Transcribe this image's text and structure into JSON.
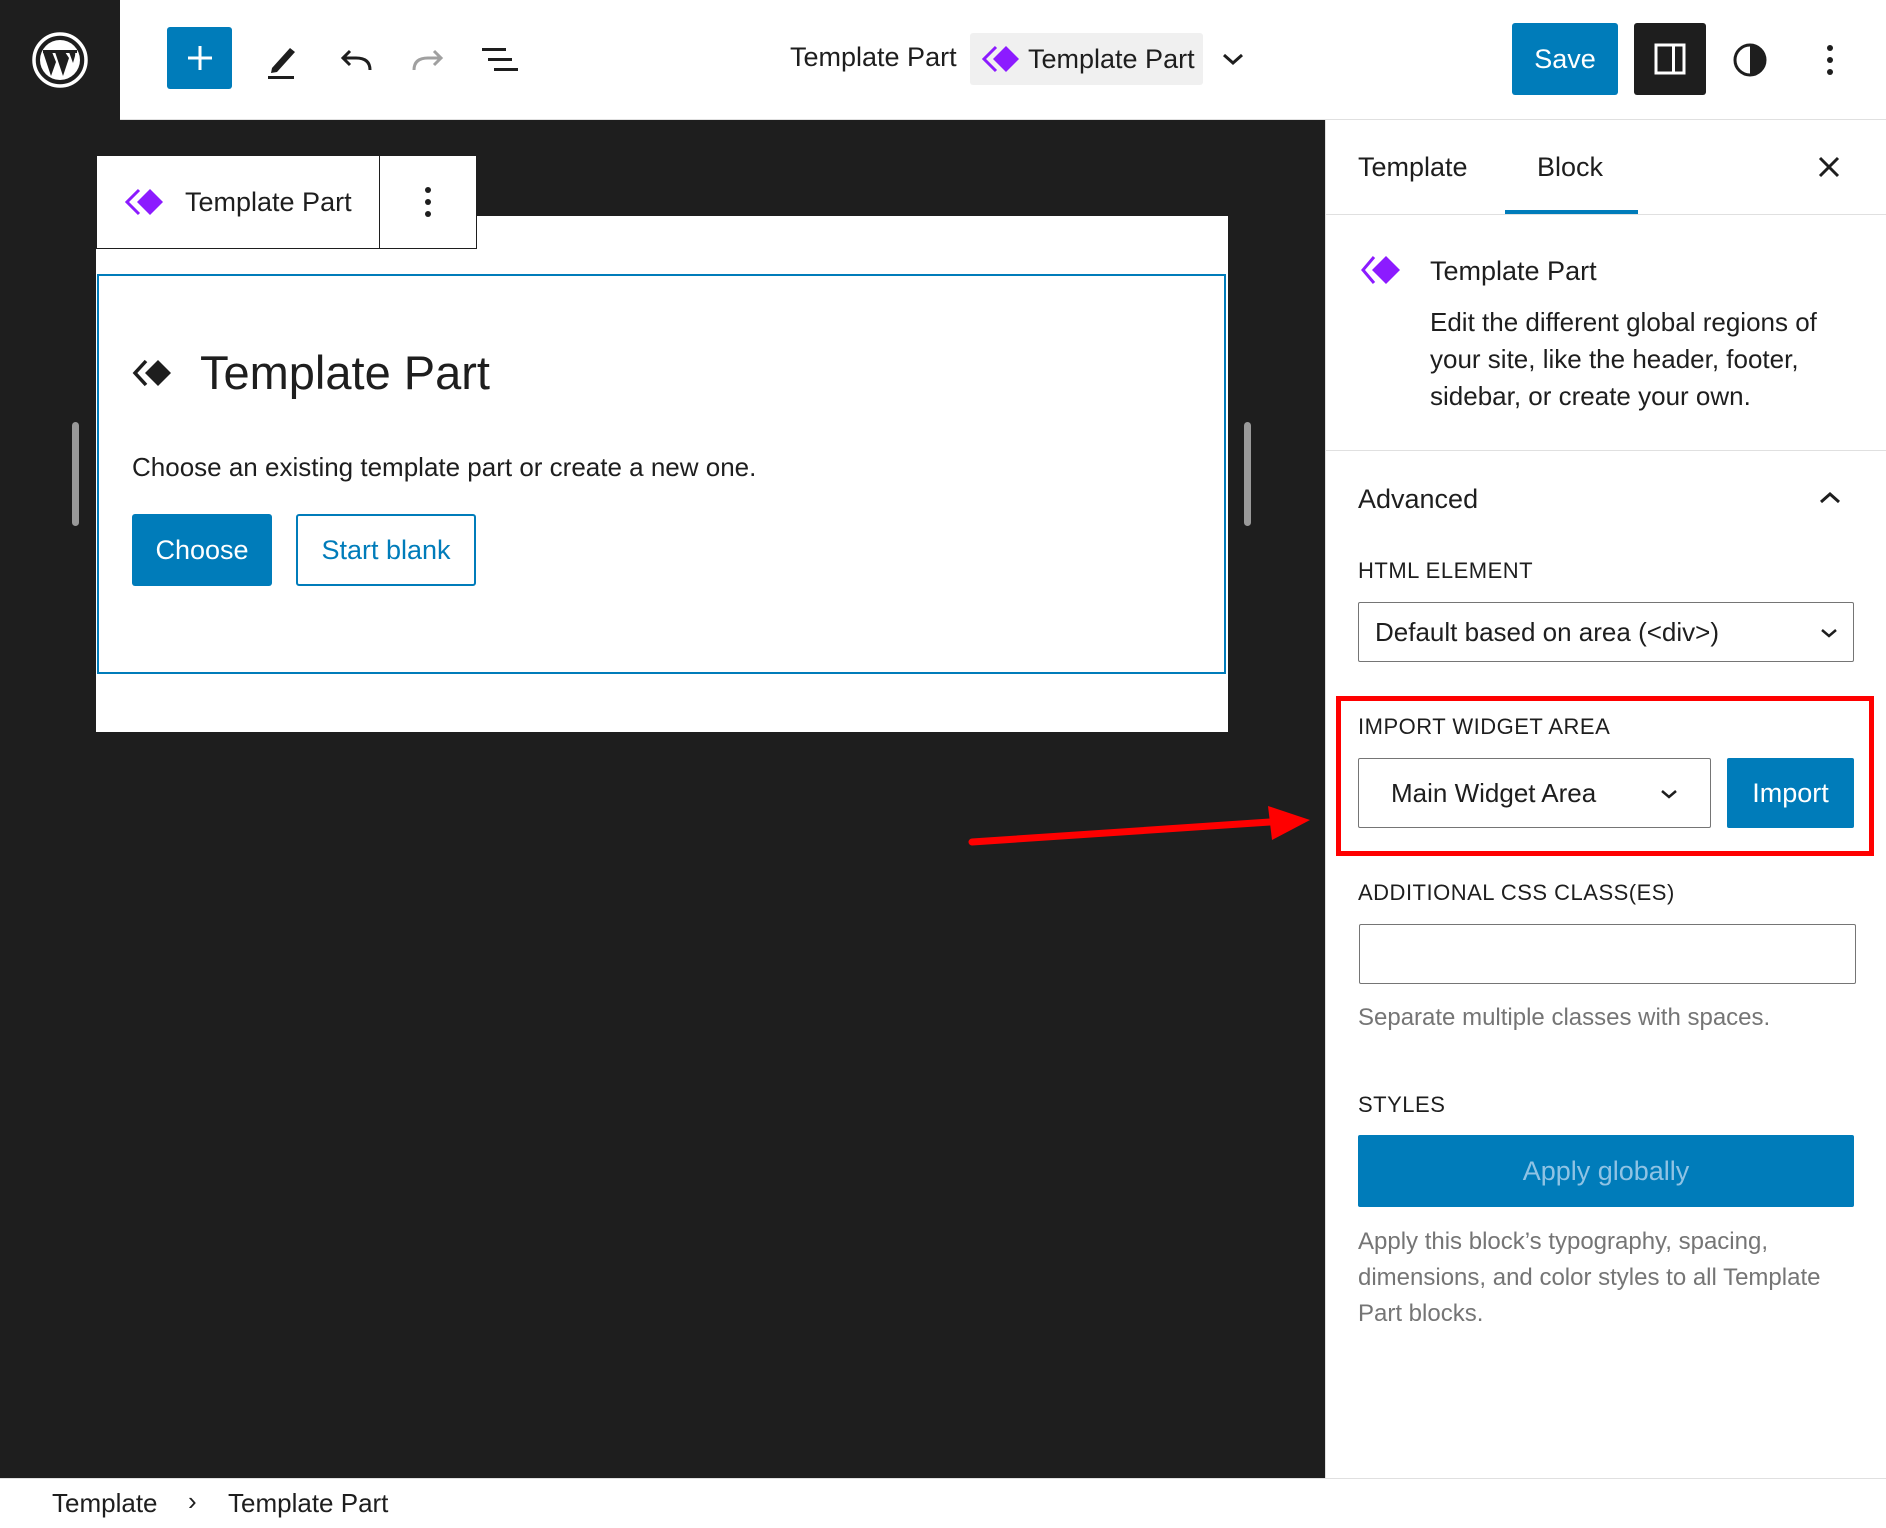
{
  "header": {
    "document_title_label": "Template Part",
    "document_title_badge": "Template Part",
    "save_label": "Save",
    "icons": [
      "wordpress-logo-icon",
      "plus-icon",
      "pencil-icon",
      "undo-icon",
      "redo-icon",
      "list-view-icon",
      "chevron-down-icon",
      "sidebar-icon",
      "half-circle-icon",
      "more-vertical-icon"
    ]
  },
  "canvas": {
    "block_toolbar_label": "Template Part",
    "placeholder": {
      "title": "Template Part",
      "description": "Choose an existing template part or create a new one.",
      "choose_label": "Choose",
      "start_blank_label": "Start blank"
    }
  },
  "sidebar": {
    "tabs": [
      {
        "label": "Template",
        "active": false
      },
      {
        "label": "Block",
        "active": true
      }
    ],
    "block_card": {
      "title": "Template Part",
      "description": "Edit the different global regions of your site, like the header, footer, sidebar, or create your own."
    },
    "advanced": {
      "title": "Advanced",
      "html_element_label": "HTML ELEMENT",
      "html_element_value": "Default based on area (<div>)",
      "import_widget_label": "IMPORT WIDGET AREA",
      "import_widget_value": "Main Widget Area",
      "import_label": "Import",
      "css_label": "ADDITIONAL CSS CLASS(ES)",
      "css_value": "",
      "css_help": "Separate multiple classes with spaces."
    },
    "styles": {
      "label": "STYLES",
      "apply_label": "Apply globally",
      "apply_help": "Apply this block’s typography, spacing, dimensions, and color styles to all Template Part blocks."
    }
  },
  "breadcrumb": {
    "items": [
      "Template",
      "Template Part"
    ],
    "separator": "›"
  },
  "colors": {
    "accent": "#007cba",
    "dark": "#1e1e1e",
    "template_part_icon": "#8c1bff",
    "annotation": "#ff0000"
  }
}
